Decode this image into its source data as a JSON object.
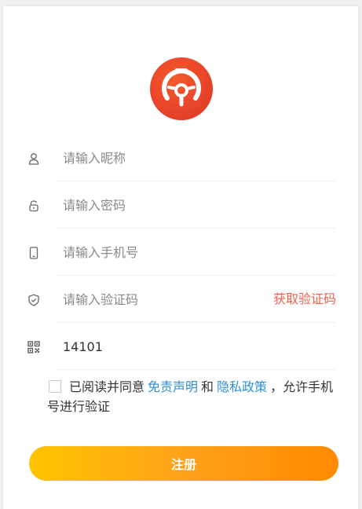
{
  "logo": {
    "icon": "steering-wheel-logo-icon",
    "color": "#e9452a"
  },
  "form": {
    "nickname_placeholder": "请输入昵称",
    "password_placeholder": "请输入密码",
    "phone_placeholder": "请输入手机号",
    "code_placeholder": "请输入验证码",
    "get_code_label": "获取验证码",
    "invite_value": "14101"
  },
  "agreement": {
    "prefix": "已阅读并同意",
    "disclaimer_link": "免责声明",
    "and": "和",
    "privacy_link": "隐私政策",
    "suffix": "，允许手机号进行验证",
    "checked": false
  },
  "register_label": "注册",
  "colors": {
    "accent": "#f0624a",
    "link": "#2f8fd8",
    "button_start": "#ffc400",
    "button_end": "#ff8a00"
  }
}
